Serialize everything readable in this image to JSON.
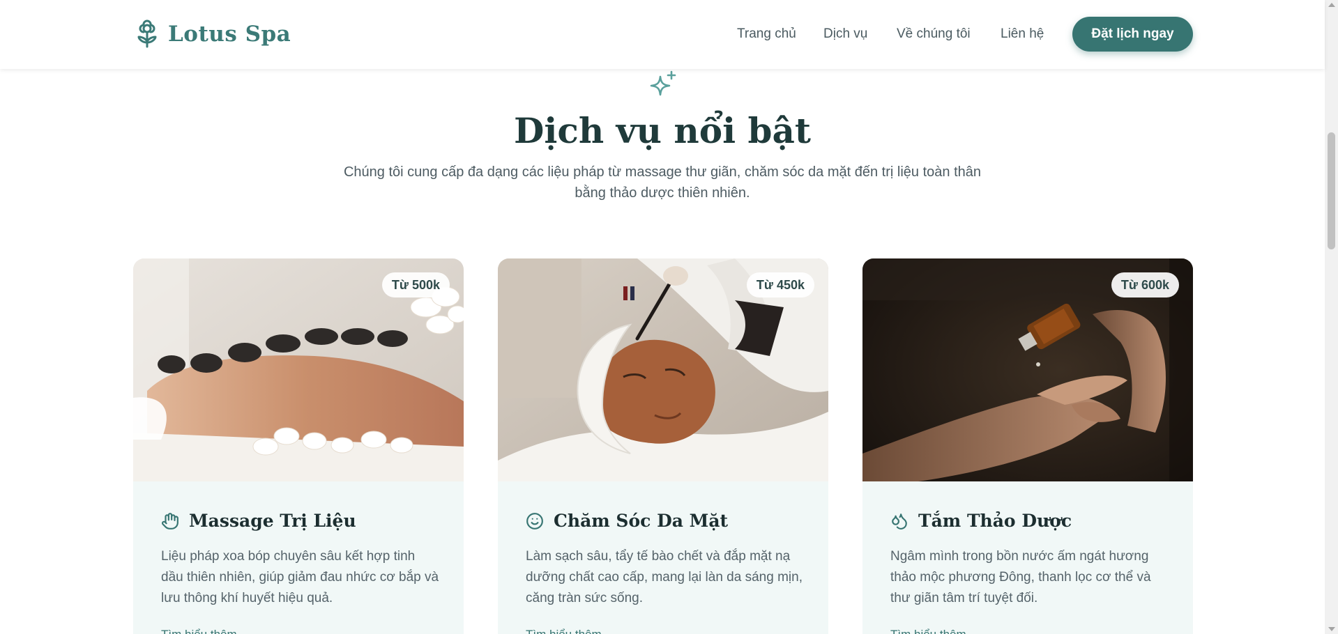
{
  "header": {
    "logo_text": "Lotus Spa",
    "nav": [
      "Trang chủ",
      "Dịch vụ",
      "Về chúng tôi",
      "Liên hệ"
    ],
    "cta_label": "Đặt lịch ngay"
  },
  "section": {
    "icon": "sparkle-icon",
    "title": "Dịch vụ nổi bật",
    "description": "Chúng tôi cung cấp đa dạng các liệu pháp từ massage thư giãn, chăm sóc da mặt đến trị liệu toàn thân bằng thảo dược thiên nhiên."
  },
  "cards": [
    {
      "price": "Từ 500k",
      "icon": "hand-icon",
      "title": "Massage Trị Liệu",
      "description": "Liệu pháp xoa bóp chuyên sâu kết hợp tinh dầu thiên nhiên, giúp giảm đau nhức cơ bắp và lưu thông khí huyết hiệu quả.",
      "link": "Tìm hiểu thêm"
    },
    {
      "price": "Từ 450k",
      "icon": "smile-icon",
      "title": "Chăm Sóc Da Mặt",
      "description": "Làm sạch sâu, tẩy tế bào chết và đắp mặt nạ dưỡng chất cao cấp, mang lại làn da sáng mịn, căng tràn sức sống.",
      "link": "Tìm hiểu thêm"
    },
    {
      "price": "Từ 600k",
      "icon": "droplets-icon",
      "title": "Tắm Thảo Dược",
      "description": "Ngâm mình trong bồn nước ấm ngát hương thảo mộc phương Đông, thanh lọc cơ thể và thư giãn tâm trí tuyệt đối.",
      "link": "Tìm hiểu thêm"
    }
  ],
  "colors": {
    "brand": "#377572",
    "brand_light": "#3b7a77",
    "card_bg": "#f1f8f7",
    "heading": "#1f3a3a"
  }
}
